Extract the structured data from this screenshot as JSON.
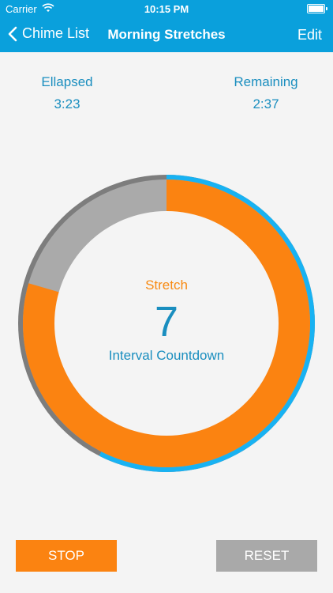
{
  "status_bar": {
    "carrier": "Carrier",
    "time": "10:15 PM",
    "wifi_icon": "wifi-icon",
    "battery_icon": "battery-icon"
  },
  "nav": {
    "back_label": "Chime List",
    "title": "Morning Stretches",
    "edit_label": "Edit"
  },
  "timer": {
    "elapsed_label": "Ellapsed",
    "elapsed_value": "3:23",
    "remaining_label": "Remaining",
    "remaining_value": "2:37",
    "interval_name": "Stretch",
    "countdown_value": "7",
    "countdown_caption": "Interval Countdown",
    "session_progress": 0.575,
    "interval_progress": 0.795
  },
  "buttons": {
    "stop_label": "STOP",
    "reset_label": "RESET"
  },
  "colors": {
    "bar": "#0aa0dc",
    "text_blue": "#1a8ebf",
    "orange": "#fb8311",
    "grey_fill": "#aaaaaa",
    "dark_grey_ring": "#7d7d7d",
    "blue_ring": "#18b2f2",
    "reset_bg": "#a9a9a9"
  }
}
